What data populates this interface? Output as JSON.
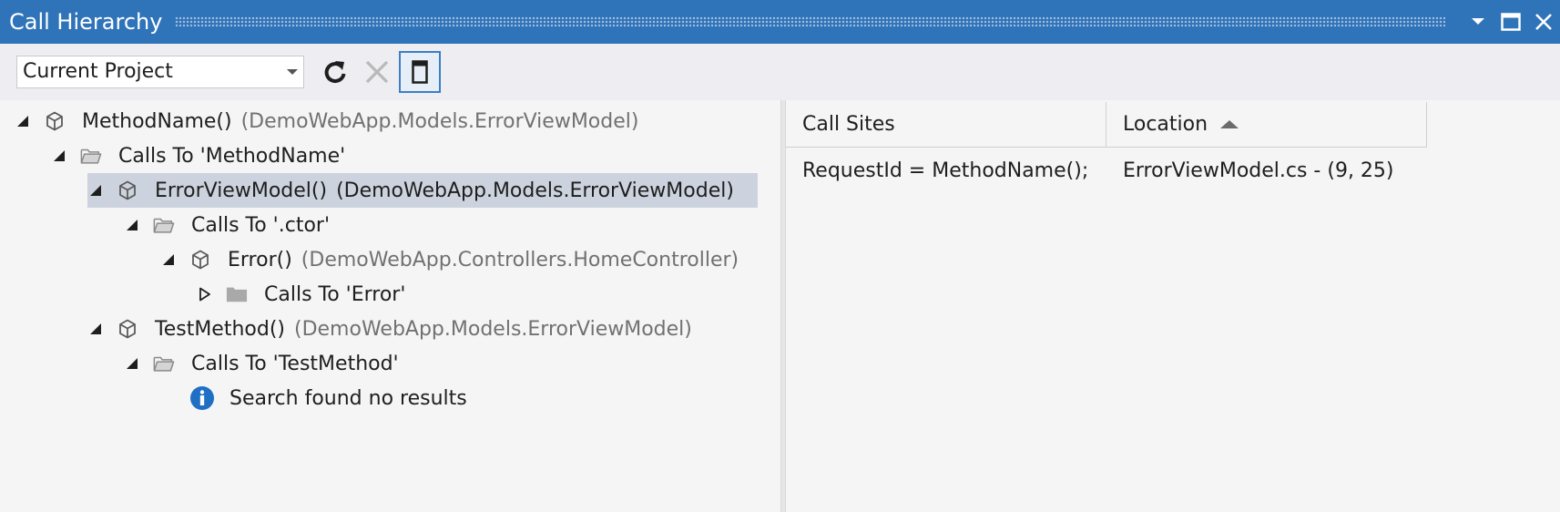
{
  "window": {
    "title": "Call Hierarchy",
    "accent_color": "#2f73b9",
    "controls": [
      "chevron-down-icon",
      "maximize-icon",
      "close-icon"
    ]
  },
  "toolbar": {
    "scope_value": "Current Project",
    "buttons": [
      "refresh-icon",
      "cancel-icon",
      "toggle-details-pane-icon"
    ]
  },
  "tree": {
    "nodes": [
      {
        "label": "MethodName()",
        "context": "(DemoWebApp.Models.ErrorViewModel)",
        "icon": "method-cube-icon",
        "expanded": true
      },
      {
        "label": "Calls To 'MethodName'",
        "icon": "folder-open-icon",
        "expanded": true
      },
      {
        "label": "ErrorViewModel()",
        "context": "(DemoWebApp.Models.ErrorViewModel)",
        "icon": "method-cube-icon",
        "expanded": true,
        "selected": true
      },
      {
        "label": "Calls To '.ctor'",
        "icon": "folder-open-icon",
        "expanded": true
      },
      {
        "label": "Error()",
        "context": "(DemoWebApp.Controllers.HomeController)",
        "icon": "method-cube-icon",
        "expanded": true
      },
      {
        "label": "Calls To 'Error'",
        "icon": "folder-closed-icon",
        "expanded": false
      },
      {
        "label": "TestMethod()",
        "context": "(DemoWebApp.Models.ErrorViewModel)",
        "icon": "method-cube-icon",
        "expanded": true
      },
      {
        "label": "Calls To 'TestMethod'",
        "icon": "folder-open-icon",
        "expanded": true
      },
      {
        "label": "Search found no results",
        "icon": "info-icon"
      }
    ]
  },
  "details": {
    "columns": [
      "Call Sites",
      "Location"
    ],
    "sort_column": "Location",
    "rows": [
      {
        "call_site": "RequestId = MethodName();",
        "location": "ErrorViewModel.cs - (9, 25)"
      }
    ]
  }
}
